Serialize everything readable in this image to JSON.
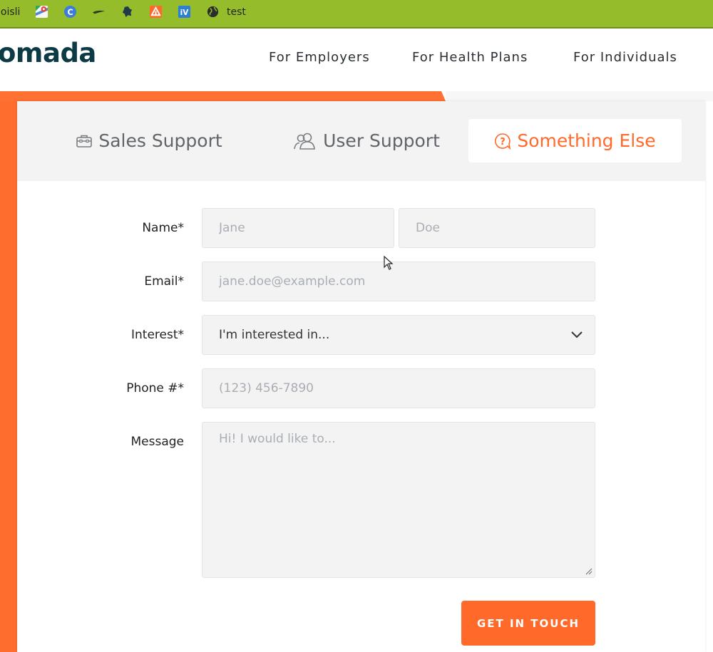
{
  "bookmarks": {
    "partial_label": "loisli",
    "items": [
      {
        "icon": "maps-icon"
      },
      {
        "icon": "c-circle-icon"
      },
      {
        "icon": "bird-icon"
      },
      {
        "icon": "bug-icon"
      },
      {
        "icon": "hubspot-icon"
      },
      {
        "icon": "iv-icon",
        "text": "iV"
      },
      {
        "icon": "globe-icon"
      }
    ],
    "last_label": "test"
  },
  "header": {
    "logo": "omada",
    "nav": [
      "For Employers",
      "For Health Plans",
      "For Individuals"
    ]
  },
  "colors": {
    "accent": "#ff6a2b",
    "brand": "#0c3a45",
    "bookmark_bar": "#95bd2b"
  },
  "tabs": [
    {
      "label": "Sales Support",
      "icon": "briefcase-icon",
      "active": false
    },
    {
      "label": "User Support",
      "icon": "users-icon",
      "active": false
    },
    {
      "label": "Something Else",
      "icon": "question-bubble-icon",
      "active": true
    }
  ],
  "form": {
    "name_label": "Name*",
    "first_placeholder": "Jane",
    "last_placeholder": "Doe",
    "email_label": "Email*",
    "email_placeholder": "jane.doe@example.com",
    "interest_label": "Interest*",
    "interest_value": "I'm interested in...",
    "phone_label": "Phone #*",
    "phone_placeholder": "(123) 456-7890",
    "message_label": "Message",
    "message_placeholder": "Hi! I would like to...",
    "submit_label": "GET IN TOUCH"
  }
}
